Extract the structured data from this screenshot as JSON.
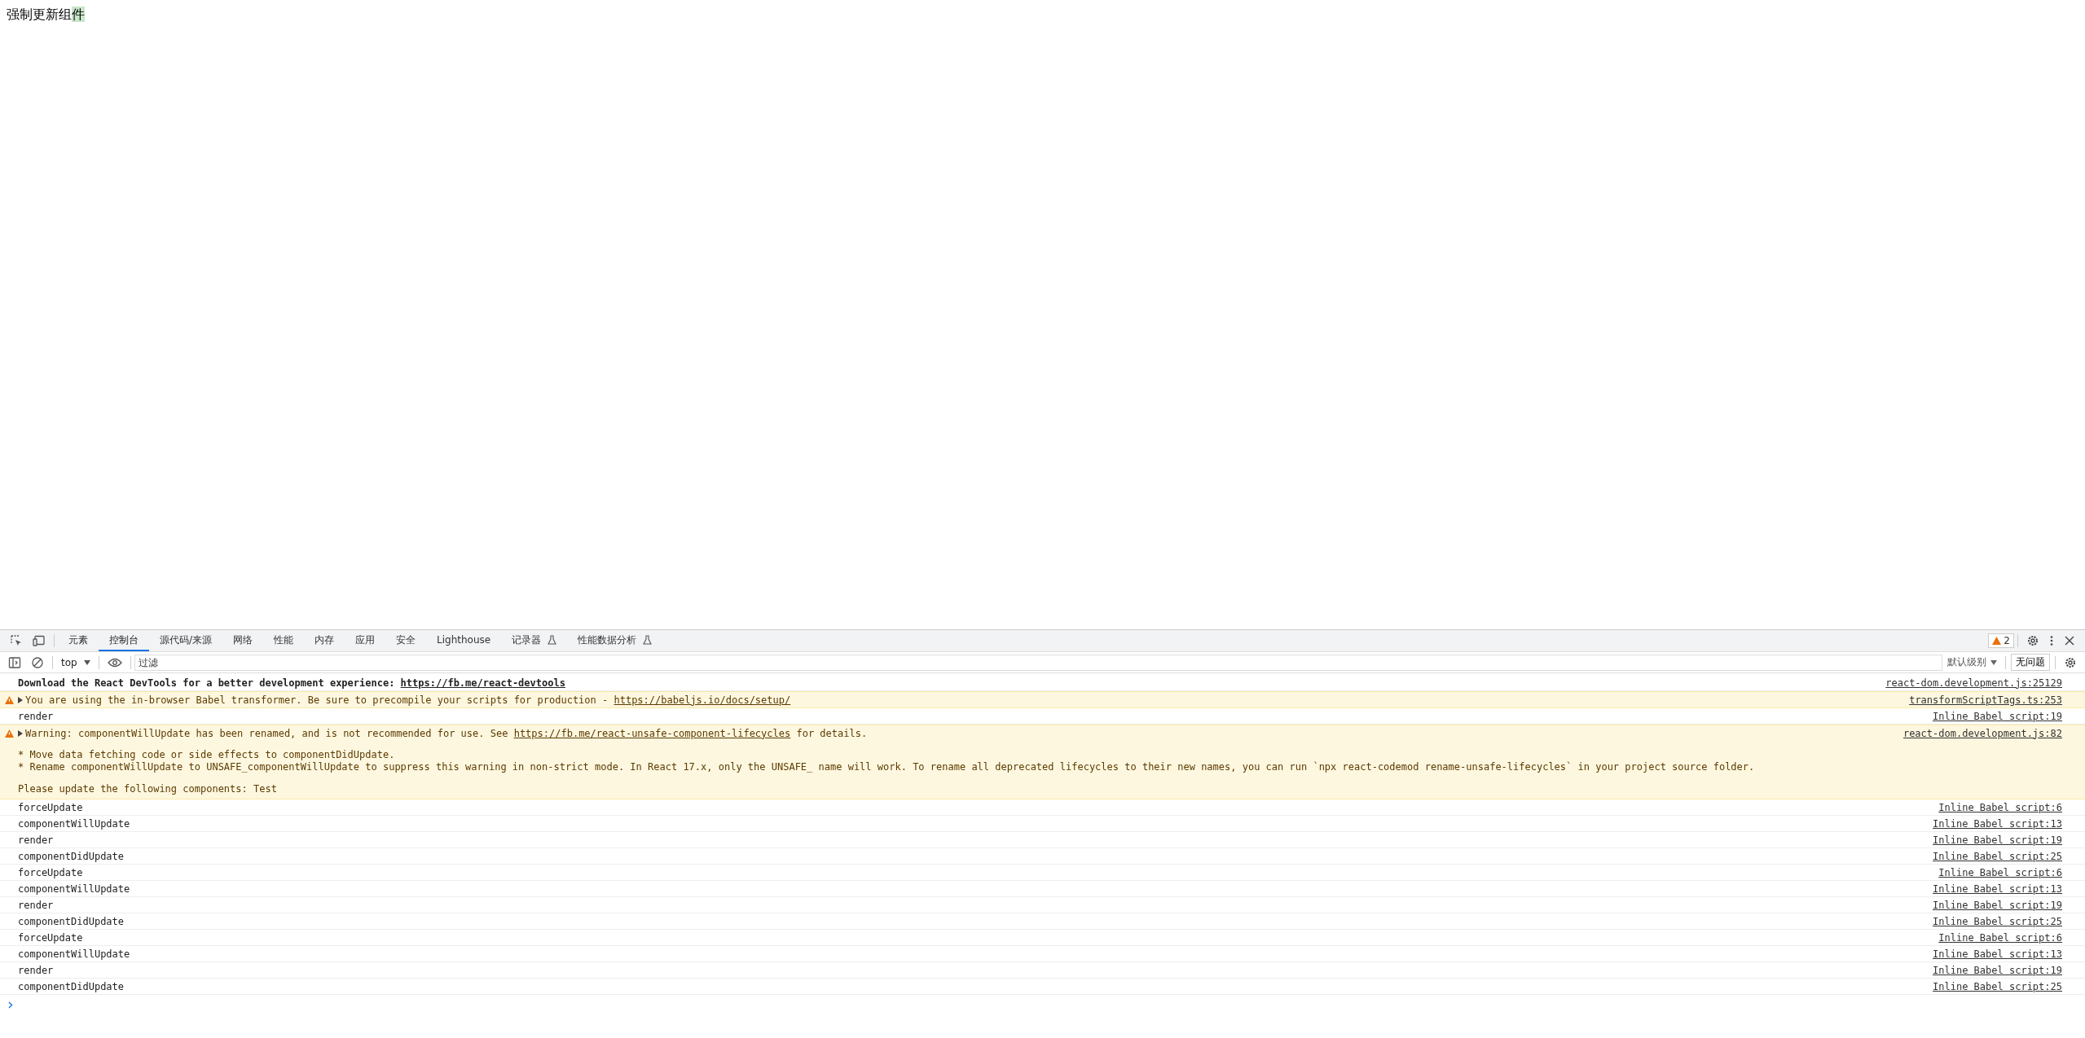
{
  "page": {
    "heading": "强制更新组",
    "highlighted": "件"
  },
  "devtools": {
    "tabs": [
      {
        "label": "元素",
        "selected": false,
        "experimental": false
      },
      {
        "label": "控制台",
        "selected": true,
        "experimental": false
      },
      {
        "label": "源代码/来源",
        "selected": false,
        "experimental": false
      },
      {
        "label": "网络",
        "selected": false,
        "experimental": false
      },
      {
        "label": "性能",
        "selected": false,
        "experimental": false
      },
      {
        "label": "内存",
        "selected": false,
        "experimental": false
      },
      {
        "label": "应用",
        "selected": false,
        "experimental": false
      },
      {
        "label": "安全",
        "selected": false,
        "experimental": false
      },
      {
        "label": "Lighthouse",
        "selected": false,
        "experimental": false
      },
      {
        "label": "记录器",
        "selected": false,
        "experimental": true
      },
      {
        "label": "性能数据分析",
        "selected": false,
        "experimental": true
      }
    ],
    "warning_count": "2",
    "toolbar": {
      "context": "top",
      "filter_placeholder": "过滤",
      "level": "默认级别",
      "issues": "无问题"
    },
    "messages": [
      {
        "kind": "info",
        "bold": true,
        "text": "Download the React DevTools for a better development experience: ",
        "link": "https://fb.me/react-devtools",
        "source": "react-dom.development.js:25129"
      },
      {
        "kind": "warning",
        "bold": false,
        "expanded": false,
        "text": "You are using the in-browser Babel transformer. Be sure to precompile your scripts for production - ",
        "link": "https://babeljs.io/docs/setup/",
        "source": "transformScriptTags.ts:253"
      },
      {
        "kind": "log",
        "text": "render",
        "source": "Inline Babel script:19"
      },
      {
        "kind": "warning",
        "bold": false,
        "expanded": false,
        "text": "Warning: componentWillUpdate has been renamed, and is not recommended for use. See ",
        "link": "https://fb.me/react-unsafe-component-lifecycles",
        "after": " for details.",
        "source": "react-dom.development.js:82",
        "details": [
          "* Move data fetching code or side effects to componentDidUpdate.\n* Rename componentWillUpdate to UNSAFE_componentWillUpdate to suppress this warning in non-strict mode. In React 17.x, only the UNSAFE_ name will work. To rename all deprecated lifecycles to their new names, you can run `npx react-codemod rename-unsafe-lifecycles` in your project source folder.",
          "Please update the following components: Test"
        ]
      },
      {
        "kind": "log",
        "text": "forceUpdate",
        "source": "Inline Babel script:6"
      },
      {
        "kind": "log",
        "text": "componentWillUpdate",
        "source": "Inline Babel script:13"
      },
      {
        "kind": "log",
        "text": "render",
        "source": "Inline Babel script:19"
      },
      {
        "kind": "log",
        "text": "componentDidUpdate",
        "source": "Inline Babel script:25"
      },
      {
        "kind": "log",
        "text": "forceUpdate",
        "source": "Inline Babel script:6"
      },
      {
        "kind": "log",
        "text": "componentWillUpdate",
        "source": "Inline Babel script:13"
      },
      {
        "kind": "log",
        "text": "render",
        "source": "Inline Babel script:19"
      },
      {
        "kind": "log",
        "text": "componentDidUpdate",
        "source": "Inline Babel script:25"
      },
      {
        "kind": "log",
        "text": "forceUpdate",
        "source": "Inline Babel script:6"
      },
      {
        "kind": "log",
        "text": "componentWillUpdate",
        "source": "Inline Babel script:13"
      },
      {
        "kind": "log",
        "text": "render",
        "source": "Inline Babel script:19"
      },
      {
        "kind": "log",
        "text": "componentDidUpdate",
        "source": "Inline Babel script:25"
      }
    ]
  }
}
